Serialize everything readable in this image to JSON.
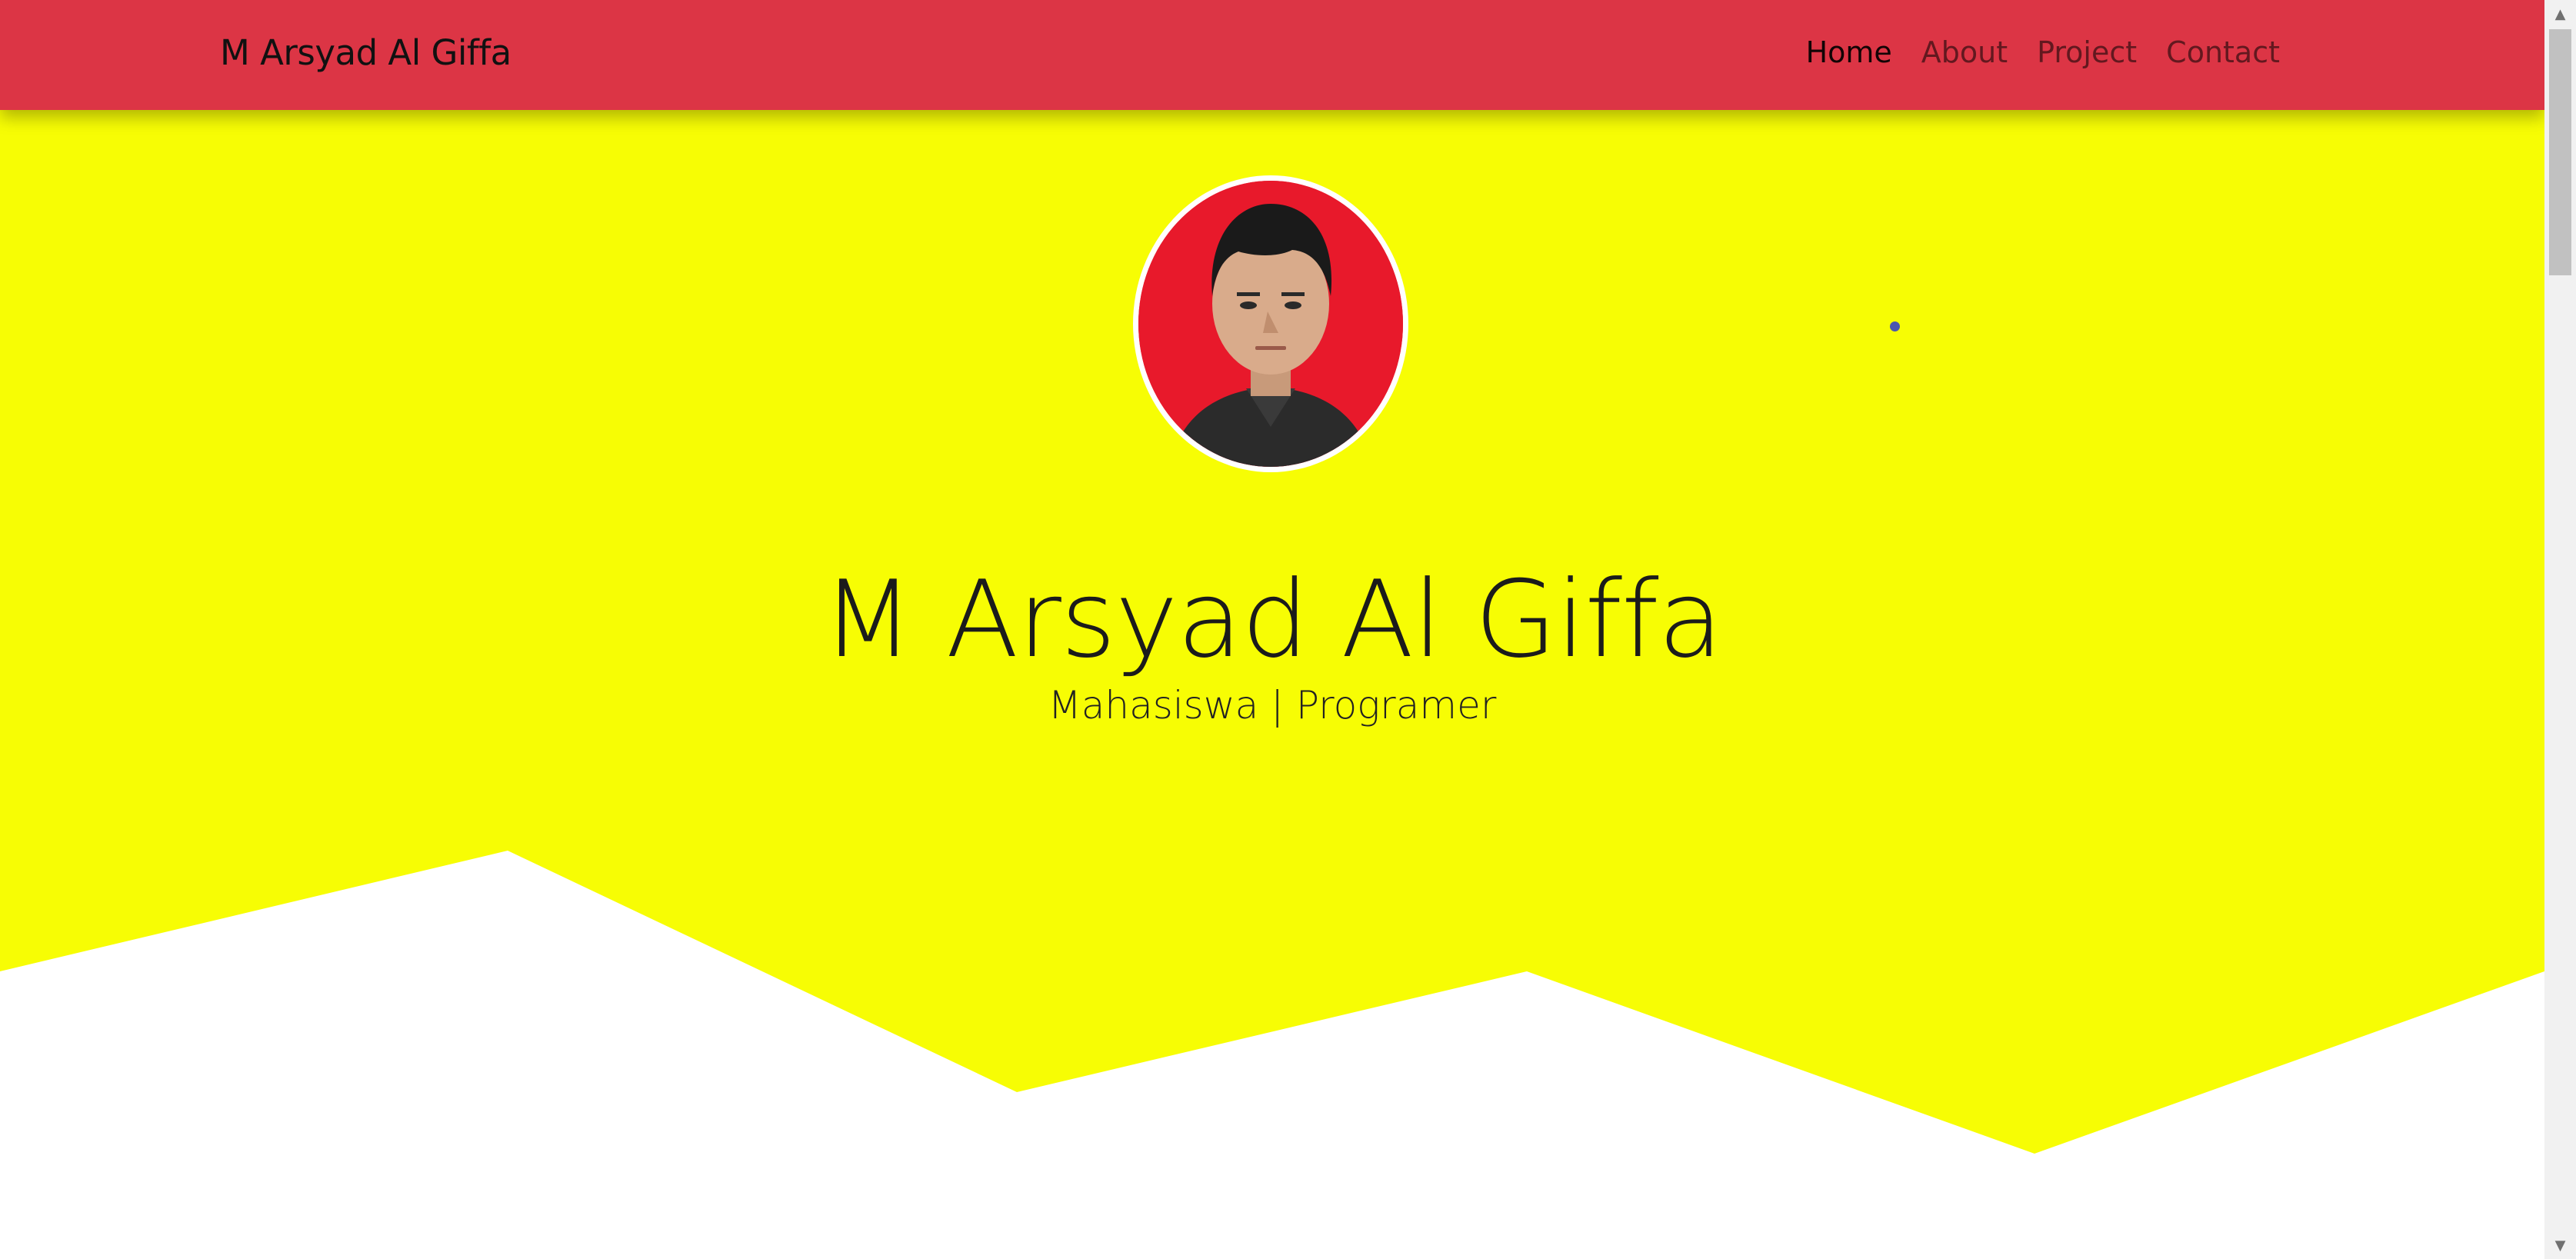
{
  "navbar": {
    "brand": "M Arsyad Al Giffa",
    "links": [
      {
        "label": "Home",
        "active": true
      },
      {
        "label": "About",
        "active": false
      },
      {
        "label": "Project",
        "active": false
      },
      {
        "label": "Contact",
        "active": false
      }
    ]
  },
  "hero": {
    "name": "M Arsyad Al Giffa",
    "subtitle": "Mahasiswa | Programer",
    "avatar_icon": "profile-photo"
  },
  "colors": {
    "navbar_bg": "#dc3545",
    "hero_bg": "#f7fd04",
    "wave_fill": "#ffffff",
    "avatar_bg": "#e8192b"
  },
  "scrollbar": {
    "up_icon": "chevron-up-icon",
    "down_icon": "chevron-down-icon"
  }
}
